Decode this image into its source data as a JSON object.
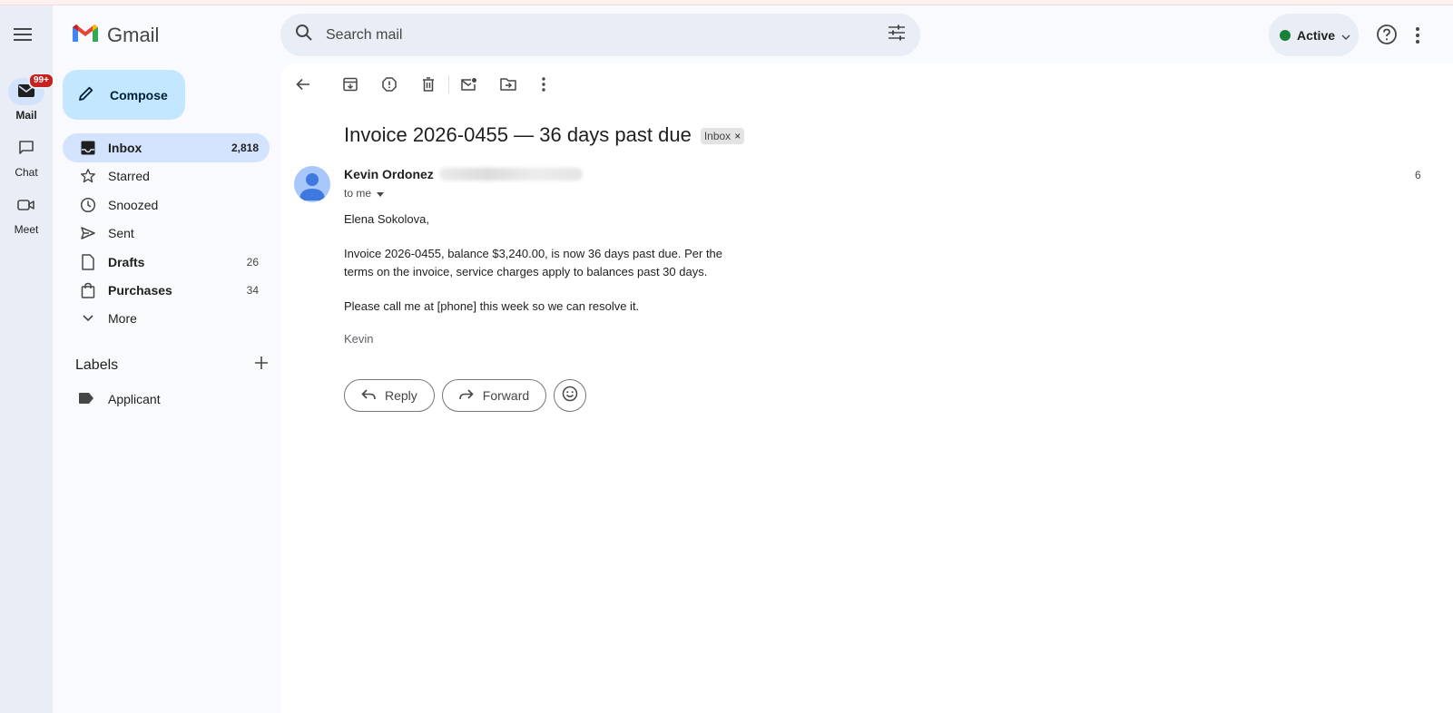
{
  "app": {
    "name": "Gmail"
  },
  "rail": {
    "items": [
      {
        "label": "Mail",
        "icon": "mail-icon",
        "badge": "99+"
      },
      {
        "label": "Chat",
        "icon": "chat-icon"
      },
      {
        "label": "Meet",
        "icon": "video-icon"
      }
    ]
  },
  "compose": {
    "label": "Compose"
  },
  "nav": {
    "items": [
      {
        "label": "Inbox",
        "count": "2,818",
        "icon": "inbox-icon"
      },
      {
        "label": "Starred",
        "count": "",
        "icon": "star-icon"
      },
      {
        "label": "Snoozed",
        "count": "",
        "icon": "clock-icon"
      },
      {
        "label": "Sent",
        "count": "",
        "icon": "send-icon"
      },
      {
        "label": "Drafts",
        "count": "26",
        "icon": "draft-icon"
      },
      {
        "label": "Purchases",
        "count": "34",
        "icon": "shopping-bag-icon"
      },
      {
        "label": "More",
        "count": "",
        "icon": "chevron-down-icon"
      }
    ]
  },
  "labels": {
    "heading": "Labels",
    "items": [
      {
        "label": "Applicant",
        "icon": "label-icon"
      }
    ]
  },
  "search": {
    "placeholder": "Search mail"
  },
  "status": {
    "label": "Active",
    "color": "#188038"
  },
  "email": {
    "subject": "Invoice 2026-0455 — 36 days past due",
    "chip": "Inbox",
    "sender_name": "Kevin Ordonez",
    "to_line": "to me",
    "date_partial": "6",
    "greeting": "Elena Sokolova,",
    "paragraph1": "Invoice 2026-0455, balance $3,240.00, is now 36 days past due. Per the terms on the invoice, service charges apply to balances past 30 days.",
    "paragraph2": "Please call me at [phone] this week so we can resolve it.",
    "signature": "Kevin"
  },
  "actions": {
    "reply": "Reply",
    "forward": "Forward"
  },
  "colors": {
    "accent": "#0b57d0",
    "active_nav": "#d3e3fd",
    "compose_bg": "#c2e7ff",
    "badge": "#c5221f"
  }
}
